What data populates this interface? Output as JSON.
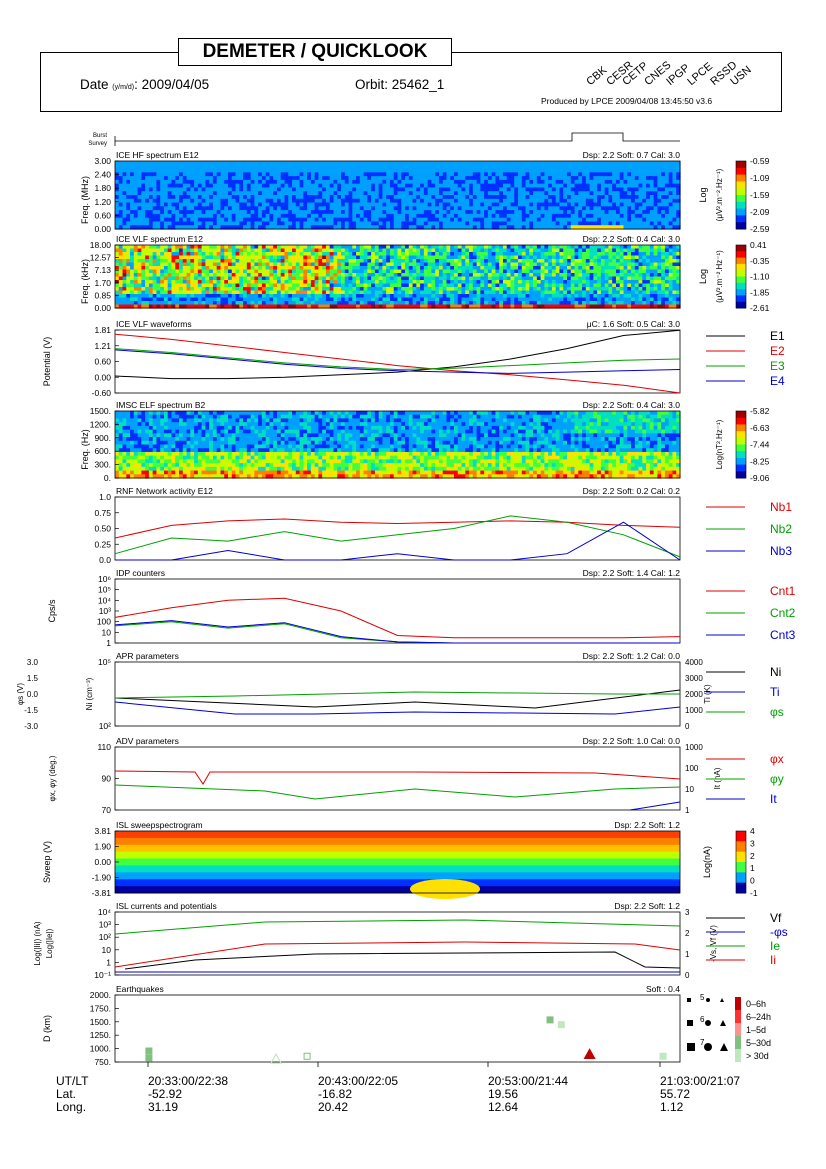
{
  "header": {
    "title": "DEMETER / QUICKLOOK",
    "date_label": "Date",
    "date_format": "(y/m/d)",
    "date_value": ": 2009/04/05",
    "orbit_label": "Orbit: 25462_1",
    "produced_by": "Produced by LPCE  2009/04/08 13:45:50  v3.6",
    "institutes": [
      "CBK",
      "CESR",
      "CETP",
      "CNES",
      "IPGP",
      "LPCE",
      "RSSD",
      "USN"
    ]
  },
  "burst_survey": {
    "burst": "Burst",
    "survey": "Survey"
  },
  "panels": {
    "ice_hf": {
      "title": "ICE HF spectrum   E12",
      "info": "Dsp: 2.2  Soft: 0.7  Cal: 3.0",
      "ylabel": "Freq. (MHz)",
      "yticks": [
        "3.00",
        "2.40",
        "1.80",
        "1.20",
        "0.60",
        "0.00"
      ],
      "cb_label1": "Log",
      "cb_label2": "(μV².m⁻².Hz⁻¹)",
      "cb_ticks": [
        "-0.59",
        "-1.09",
        "-1.59",
        "-2.09",
        "-2.59"
      ]
    },
    "ice_vlf": {
      "title": "ICE VLF spectrum   E12",
      "info": "Dsp: 2.2  Soft: 0.4  Cal: 3.0",
      "ylabel": "Freq. (kHz)",
      "yticks": [
        "18.00",
        "12.57",
        "7.13",
        "1.70",
        "0.85",
        "0.00"
      ],
      "cb_label1": "Log",
      "cb_label2": "(μV².m⁻².Hz⁻¹)",
      "cb_ticks": [
        "0.41",
        "-0.35",
        "-1.10",
        "-1.85",
        "-2.61"
      ]
    },
    "ice_wave": {
      "title": "ICE VLF waveforms",
      "info": "μC: 1.6  Soft: 0.5  Cal: 3.0",
      "ylabel": "Potential (V)",
      "yticks": [
        "1.81",
        "1.21",
        "0.60",
        "0.00",
        "-0.60"
      ],
      "legend": [
        "E1",
        "E2",
        "E3",
        "E4"
      ]
    },
    "imsc": {
      "title": "IMSC ELF spectrum   B2",
      "info": "Dsp: 2.2  Soft: 0.4  Cal: 3.0",
      "ylabel": "Freq. (Hz)",
      "yticks": [
        "1500.",
        "1200.",
        "900.",
        "600.",
        "300.",
        "0."
      ],
      "cb_label1": "Log(nT².Hz⁻¹)",
      "cb_ticks": [
        "-5.82",
        "-6.63",
        "-7.44",
        "-8.25",
        "-9.06"
      ]
    },
    "rnf": {
      "title": "RNF Network activity   E12",
      "info": "Dsp: 2.2  Soft: 0.2  Cal: 0.2",
      "yticks": [
        "1.0",
        "0.75",
        "0.50",
        "0.25",
        "0.0"
      ],
      "legend": [
        "Nb1",
        "Nb2",
        "Nb3"
      ]
    },
    "idp": {
      "title": "IDP counters",
      "info": "Dsp: 2.2  Soft: 1.4  Cal: 1.2",
      "ylabel": "Cps/s",
      "yticks": [
        "10⁶",
        "10⁵",
        "10⁴",
        "10³",
        "100",
        "10",
        "1"
      ],
      "legend": [
        "Cnt1",
        "Cnt2",
        "Cnt3"
      ]
    },
    "apr": {
      "title": "APR parameters",
      "info": "Dsp: 2.2  Soft: 1.2  Cal: 0.0",
      "ylabel_left": "Ni (cm⁻³)",
      "ylabel_far_left": "φs (V)",
      "ylabel_right": "Ti (K)",
      "yticks_left": [
        "10⁵",
        "10²"
      ],
      "yticks_far_left": [
        "3.0",
        "1.5",
        "0.0",
        "-1.5",
        "-3.0"
      ],
      "yticks_right": [
        "4000",
        "3000",
        "2000",
        "1000",
        "0"
      ],
      "legend": [
        "Ni",
        "Ti",
        "φs"
      ]
    },
    "adv": {
      "title": "ADV parameters",
      "info": "Dsp: 2.2  Soft: 1.0  Cal: 0.0",
      "ylabel_left": "φx, φy (deg.)",
      "ylabel_right": "It (nA)",
      "yticks_left": [
        "110",
        "90",
        "70"
      ],
      "yticks_right": [
        "1000",
        "100",
        "10",
        "1"
      ],
      "legend": [
        "φx",
        "φy",
        "It"
      ]
    },
    "isl_sweep": {
      "title": "ISL sweepspectrogram",
      "info": "Dsp: 2.2  Soft: 1.2",
      "ylabel": "Sweep (V)",
      "yticks": [
        "3.81",
        "1.90",
        "0.00",
        "-1.90",
        "-3.81"
      ],
      "cb_label1": "Log(nA)",
      "cb_ticks": [
        "4",
        "3",
        "2",
        "1",
        "0",
        "-1"
      ]
    },
    "isl_curr": {
      "title": "ISL currents and potentials",
      "info": "Dsp: 2.2  Soft: 1.2",
      "ylabel_left1": "Log(|Ii|) (nA)",
      "ylabel_left2": "Log(|Ie|)",
      "ylabel_right": "-Vs, Vf (V)",
      "yticks_left": [
        "10⁴",
        "10³",
        "10²",
        "10",
        "1",
        "10⁻¹"
      ],
      "yticks_right": [
        "3",
        "2",
        "1",
        "0"
      ],
      "legend": [
        "Vf",
        "-φs",
        "Ie",
        "Ii"
      ]
    },
    "eq": {
      "title": "Earthquakes",
      "info": "Soft : 0.4",
      "ylabel": "D  (km)",
      "yticks": [
        "2000.",
        "1750.",
        "1500.",
        "1250.",
        "1000.",
        "750."
      ],
      "mag_labels": [
        "5",
        "6",
        "7"
      ],
      "age_legend": [
        "0–6h",
        "6–24h",
        "1–5d",
        "5–30d",
        "> 30d"
      ]
    }
  },
  "time_axis": {
    "row_labels": [
      "UT/LT",
      "Lat.",
      "Long."
    ],
    "ticks": [
      {
        "utlt": "20:33:00/22:38",
        "lat": "-52.92",
        "long": "31.19"
      },
      {
        "utlt": "20:43:00/22:05",
        "lat": "-16.82",
        "long": "20.42"
      },
      {
        "utlt": "20:53:00/21:44",
        "lat": "19.56",
        "long": "12.64"
      },
      {
        "utlt": "21:03:00/21:07",
        "lat": "55.72",
        "long": "1.12"
      }
    ]
  },
  "colors": {
    "black": "#000000",
    "red": "#dd0000",
    "green": "#00a000",
    "blue": "#0000cc"
  },
  "chart_data": [
    {
      "type": "line",
      "id": "ice_wave",
      "title": "ICE VLF waveforms",
      "ylabel": "Potential (V)",
      "ylim": [
        -0.6,
        1.81
      ],
      "x": [
        0,
        0.1,
        0.2,
        0.3,
        0.4,
        0.5,
        0.6,
        0.7,
        0.8,
        0.9,
        1.0
      ],
      "series": [
        {
          "name": "E1",
          "values": [
            0.05,
            -0.05,
            -0.05,
            0.0,
            0.1,
            0.2,
            0.4,
            0.7,
            1.1,
            1.6,
            1.8
          ]
        },
        {
          "name": "E2",
          "values": [
            1.65,
            1.45,
            1.2,
            0.95,
            0.7,
            0.45,
            0.25,
            0.1,
            -0.1,
            -0.3,
            -0.6
          ]
        },
        {
          "name": "E3",
          "values": [
            1.1,
            0.95,
            0.75,
            0.55,
            0.4,
            0.3,
            0.35,
            0.45,
            0.55,
            0.65,
            0.7
          ]
        },
        {
          "name": "E4",
          "values": [
            1.05,
            0.9,
            0.7,
            0.5,
            0.35,
            0.25,
            0.2,
            0.15,
            0.2,
            0.25,
            0.3
          ]
        }
      ]
    },
    {
      "type": "line",
      "id": "rnf",
      "title": "RNF Network activity   E12",
      "ylim": [
        0,
        1.0
      ],
      "x": [
        0,
        0.1,
        0.2,
        0.3,
        0.4,
        0.5,
        0.6,
        0.7,
        0.8,
        0.9,
        1.0
      ],
      "series": [
        {
          "name": "Nb1",
          "values": [
            0.35,
            0.55,
            0.62,
            0.65,
            0.6,
            0.58,
            0.6,
            0.62,
            0.6,
            0.55,
            0.52
          ]
        },
        {
          "name": "Nb2",
          "values": [
            0.1,
            0.35,
            0.3,
            0.45,
            0.3,
            0.4,
            0.5,
            0.7,
            0.6,
            0.4,
            0.05
          ]
        },
        {
          "name": "Nb3",
          "values": [
            0.0,
            0.0,
            0.15,
            0.0,
            0.0,
            0.1,
            0.0,
            0.0,
            0.1,
            0.6,
            0.0
          ]
        }
      ]
    },
    {
      "type": "line",
      "id": "idp",
      "title": "IDP counters",
      "ylabel": "Cps/s",
      "ylim_log10": [
        0,
        6
      ],
      "x": [
        0,
        0.1,
        0.2,
        0.3,
        0.4,
        0.5,
        0.6,
        0.7,
        0.8,
        0.9,
        1.0
      ],
      "series": [
        {
          "name": "Cnt1",
          "values_log10": [
            2.4,
            3.3,
            4.0,
            4.2,
            3.0,
            0.7,
            0.5,
            0.5,
            0.5,
            0.5,
            0.6
          ]
        },
        {
          "name": "Cnt2",
          "values_log10": [
            1.6,
            2.0,
            1.4,
            1.8,
            0.5,
            0.1,
            0.0,
            0.0,
            0.0,
            0.0,
            0.0
          ]
        },
        {
          "name": "Cnt3",
          "values_log10": [
            1.7,
            2.1,
            1.5,
            1.9,
            0.6,
            0.1,
            0.0,
            0.0,
            0.0,
            0.0,
            0.0
          ]
        }
      ]
    },
    {
      "type": "scatter",
      "id": "eq",
      "title": "Earthquakes",
      "ylabel": "D  (km)",
      "ylim": [
        700,
        2100
      ],
      "points": [
        {
          "x": 0.06,
          "d": 930,
          "shape": "square",
          "age": "5-30d"
        },
        {
          "x": 0.06,
          "d": 780,
          "shape": "square",
          "age": "5-30d"
        },
        {
          "x": 0.285,
          "d": 760,
          "shape": "triangle",
          "age": "> 30d",
          "outline": true
        },
        {
          "x": 0.34,
          "d": 820,
          "shape": "square",
          "age": "5-30d",
          "outline": true
        },
        {
          "x": 0.77,
          "d": 1580,
          "shape": "square",
          "age": "5-30d"
        },
        {
          "x": 0.79,
          "d": 1480,
          "shape": "square",
          "age": "> 30d"
        },
        {
          "x": 0.84,
          "d": 860,
          "shape": "triangle",
          "age": "0-6h"
        },
        {
          "x": 0.97,
          "d": 820,
          "shape": "square",
          "age": "> 30d"
        }
      ]
    }
  ]
}
